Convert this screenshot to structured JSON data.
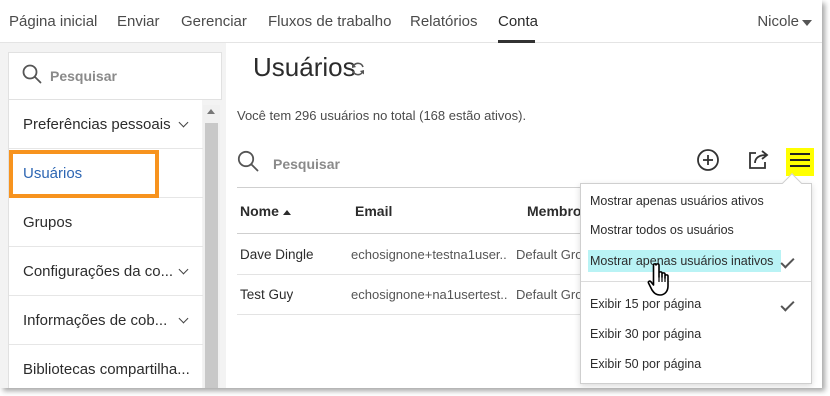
{
  "nav": {
    "items": [
      {
        "label": "Página inicial"
      },
      {
        "label": "Enviar"
      },
      {
        "label": "Gerenciar"
      },
      {
        "label": "Fluxos de trabalho"
      },
      {
        "label": "Relatórios"
      },
      {
        "label": "Conta"
      }
    ],
    "active": "Conta",
    "user": "Nicole"
  },
  "sidebar": {
    "search_placeholder": "Pesquisar",
    "items": [
      {
        "label": "Preferências pessoais",
        "expandable": true
      },
      {
        "label": "Usuários",
        "selected": true
      },
      {
        "label": "Grupos"
      },
      {
        "label": "Configurações da co...",
        "expandable": true
      },
      {
        "label": "Informações de cob...",
        "expandable": true
      },
      {
        "label": "Bibliotecas compartilha..."
      }
    ]
  },
  "main": {
    "title": "Usuários",
    "summary": "Você tem 296 usuários no total (168 estão ativos).",
    "search_placeholder": "Pesquisar",
    "table": {
      "columns": [
        "Nome",
        "Email",
        "Membro"
      ],
      "rows": [
        {
          "name": "Dave Dingle",
          "email": "echosignone+testna1user..",
          "group": "Default Gro"
        },
        {
          "name": "Test Guy",
          "email": "echosignone+na1usertest..",
          "group": "Default Gro"
        }
      ]
    }
  },
  "menu": {
    "items": [
      {
        "label": "Mostrar apenas usuários ativos",
        "checked": false
      },
      {
        "label": "Mostrar todos os usuários",
        "checked": false
      },
      {
        "label": "Mostrar apenas usuários inativos",
        "checked": true,
        "highlighted": true
      },
      {
        "label": "Exibir 15 por página",
        "checked": true
      },
      {
        "label": "Exibir 30 por página",
        "checked": false
      },
      {
        "label": "Exibir 50 por página",
        "checked": false
      }
    ]
  },
  "colors": {
    "highlight_box": "#f7931e",
    "menu_button_bg": "#ffff00",
    "menu_item_highlight": "#b9f3f5",
    "selected_link": "#2d66b3"
  },
  "icons": [
    "search-icon",
    "refresh-icon",
    "add-user-icon",
    "export-icon",
    "hamburger-menu-icon",
    "hand-cursor-icon"
  ]
}
